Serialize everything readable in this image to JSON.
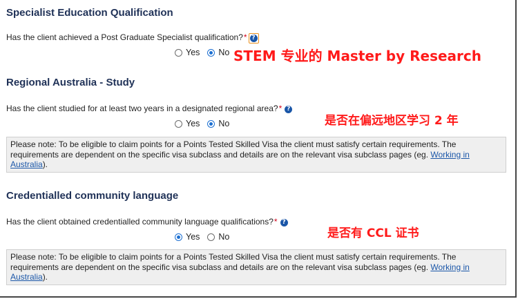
{
  "sections": [
    {
      "heading": "Specialist Education Qualification",
      "question": "Has the client achieved a Post Graduate Specialist qualification?",
      "required_mark": "*",
      "help_icon": "question-circle-icon",
      "options": [
        "Yes",
        "No"
      ],
      "selected": "No"
    },
    {
      "heading": "Regional Australia - Study",
      "question": "Has the client studied for at least two years in a designated regional area?",
      "required_mark": "*",
      "help_icon": "question-circle-icon",
      "options": [
        "Yes",
        "No"
      ],
      "selected": "No",
      "note_text": "Please note: To be eligible to claim points for a Points Tested Skilled Visa the client must satisfy certain requirements. The requirements are dependent on the specific visa subclass and details are on the relevant visa subclass pages (eg. ",
      "note_link": "Working in Australia",
      "note_end": ")."
    },
    {
      "heading": "Credentialled community language",
      "question": "Has the client obtained credentialled community language qualifications?",
      "required_mark": "*",
      "help_icon": "question-circle-icon",
      "options": [
        "Yes",
        "No"
      ],
      "selected": "Yes",
      "note_text": "Please note: To be eligible to claim points for a Points Tested Skilled Visa the client must satisfy certain requirements. The requirements are dependent on the specific visa subclass and details are on the relevant visa subclass pages (eg. ",
      "note_link": "Working in Australia",
      "note_end": ")."
    }
  ],
  "annotations": {
    "a1": "STEM 专业的 Master by Research",
    "a2": "是否在偏远地区学习 2 年",
    "a3": "是否有 CCL 证书"
  },
  "colors": {
    "heading": "#1f3157",
    "annotation": "#ff1a1a",
    "link": "#1a56a8",
    "note_bg": "#efefef"
  }
}
